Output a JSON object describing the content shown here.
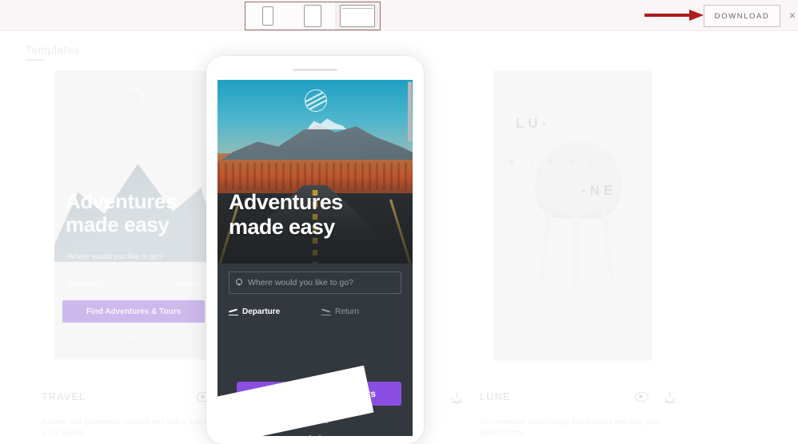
{
  "toolbar": {
    "device_options": [
      {
        "id": "phone",
        "label": "Phone",
        "icon": "phone-icon",
        "active": false
      },
      {
        "id": "tablet",
        "label": "Tablet",
        "icon": "tablet-icon",
        "active": false
      },
      {
        "id": "desktop",
        "label": "Desktop",
        "icon": "desktop-icon",
        "active": true
      }
    ],
    "download_label": "DOWNLOAD",
    "close_label": "×",
    "annotation_arrow_color": "#b01b1b"
  },
  "background_page": {
    "title": "Templates",
    "cards": [
      {
        "name": "TRAVEL",
        "description": "A travel and experience focused one with a bold hero and quick search.",
        "eye_icon": "eye-icon",
        "download_icon": "download-icon",
        "thumb": {
          "heading": "Adventures made easy",
          "subtitle": "Where would you like to go?",
          "tab_left": "Departure",
          "tab_right": "Return",
          "cta": "Find Adventures & Tours",
          "explore": "Explore"
        }
      },
      {
        "name": "LUNE",
        "description": "An immersive walkthrough that teaches and tells your product story.",
        "eye_icon": "eye-icon",
        "download_icon": "download-icon",
        "thumb": {
          "word_top": "LU-",
          "word_mid": "B L A N C",
          "word_bottom": "-NE"
        }
      }
    ]
  },
  "preview": {
    "device": "phone",
    "logo_icon": "globe-logo-icon",
    "hero_heading": "Adventures made easy",
    "search": {
      "icon": "map-pin-icon",
      "placeholder": "Where would you like to go?",
      "value": ""
    },
    "segments": [
      {
        "label": "Departure",
        "icon": "plane-takeoff-icon",
        "active": true
      },
      {
        "label": "Return",
        "icon": "plane-landing-icon",
        "active": false
      }
    ],
    "cta_label": "Find Adventures & Tours",
    "cta_color": "#8a4ee2",
    "explore_label": "Explore",
    "chevron_icon": "chevron-down-icon"
  }
}
